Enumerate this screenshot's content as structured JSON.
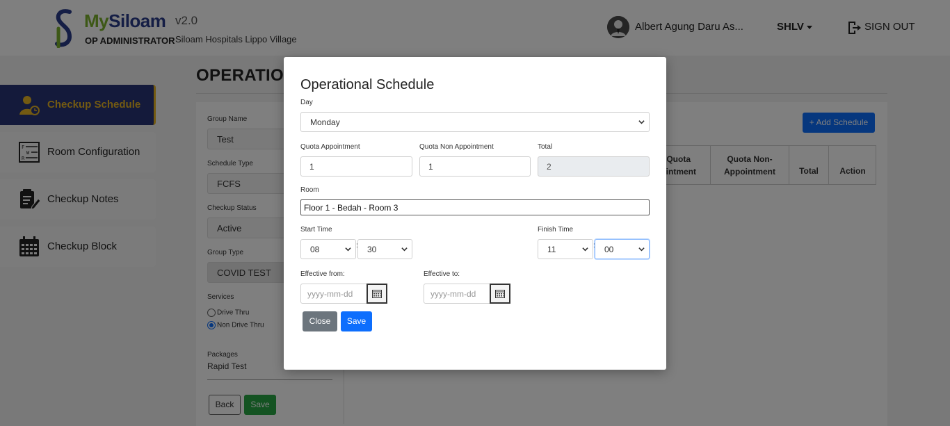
{
  "header": {
    "brand_my": "My",
    "brand_siloam": "Siloam",
    "version": "v2.0",
    "subtitle": "OP ADMINISTRATOR",
    "hospital_name": "Siloam Hospitals Lippo Village",
    "username": "Albert Agung Daru As...",
    "hospital_code": "SHLV",
    "signout_label": "SIGN OUT"
  },
  "sidebar": {
    "items": [
      {
        "label": "Checkup Schedule",
        "icon": "doctor-clock-icon",
        "active": true
      },
      {
        "label": "Room Configuration",
        "icon": "room-grid-icon",
        "active": false
      },
      {
        "label": "Checkup Notes",
        "icon": "notes-pencil-icon",
        "active": false
      },
      {
        "label": "Checkup Block",
        "icon": "calendar-grid-icon",
        "active": false
      }
    ]
  },
  "page": {
    "title": "OPERATION",
    "form": {
      "group_name_label": "Group Name",
      "group_name_value": "Test",
      "schedule_type_label": "Schedule Type",
      "schedule_type_value": "FCFS",
      "checkup_status_label": "Checkup Status",
      "checkup_status_value": "Active",
      "group_type_label": "Group Type",
      "group_type_value": "COVID TEST",
      "services_label": "Services",
      "services_options": [
        {
          "label": "Drive Thru",
          "selected": false
        },
        {
          "label": "Non Drive Thru",
          "selected": true
        }
      ],
      "packages_label": "Packages",
      "packages_value": "Rapid Test",
      "back_label": "Back",
      "save_label": "Save"
    },
    "add_schedule_label": "+ Add Schedule",
    "table_headers": [
      "Quota Appointment",
      "Quota Non-Appointment",
      "Total",
      "Action"
    ],
    "table_header_partial": "Quota\nointment"
  },
  "modal": {
    "title": "Operational Schedule",
    "day_label": "Day",
    "day_value": "Monday",
    "quota_appointment_label": "Quota Appointment",
    "quota_appointment_value": "1",
    "quota_non_appointment_label": "Quota Non Appointment",
    "quota_non_appointment_value": "1",
    "total_label": "Total",
    "total_value": "2",
    "room_label": "Room",
    "room_value": "Floor 1 - Bedah - Room 3",
    "start_time_label": "Start Time",
    "start_hour": "08",
    "start_minute": "30",
    "finish_time_label": "Finish Time",
    "finish_hour": "11",
    "finish_minute": "00",
    "time_separator": ":",
    "effective_from_label": "Effective from:",
    "effective_from_placeholder": "yyyy-mm-dd",
    "effective_to_label": "Effective to:",
    "effective_to_placeholder": "yyyy-mm-dd",
    "close_label": "Close",
    "save_label": "Save"
  },
  "colors": {
    "brand_green": "#7ab02c",
    "brand_blue": "#2b3c8a",
    "sidebar_active_bg": "#283476",
    "sidebar_active_text": "#e7b425",
    "primary": "#0d6efd",
    "success": "#28a745",
    "secondary": "#6c757d"
  }
}
